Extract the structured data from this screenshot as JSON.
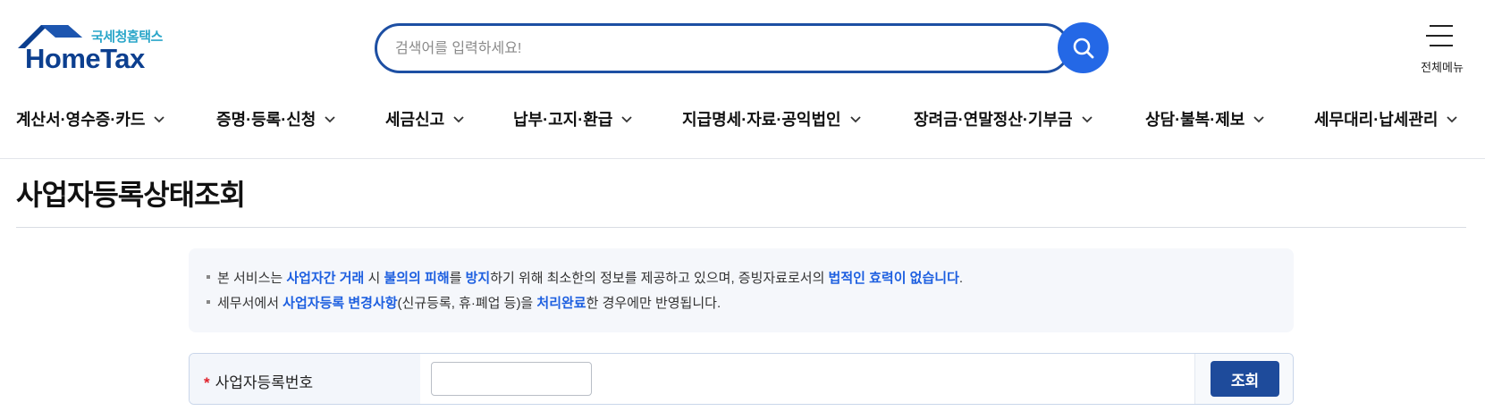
{
  "header": {
    "logo_sub": "국세청홈택스",
    "logo_main": "HomeTax",
    "search_placeholder": "검색어를 입력하세요!",
    "search_value": "",
    "menu_label": "전체메뉴"
  },
  "nav": {
    "items": [
      {
        "label": "계산서·영수증·카드"
      },
      {
        "label": "증명·등록·신청"
      },
      {
        "label": "세금신고"
      },
      {
        "label": "납부·고지·환급"
      },
      {
        "label": "지급명세·자료·공익법인"
      },
      {
        "label": "장려금·연말정산·기부금"
      },
      {
        "label": "상담·불복·제보"
      },
      {
        "label": "세무대리·납세관리"
      }
    ]
  },
  "page": {
    "title": "사업자등록상태조회"
  },
  "notice": {
    "line1": {
      "t1": "본 서비스는 ",
      "h1": "사업자간 거래",
      "t2": " 시 ",
      "h2": "불의의 피해",
      "t3": "를 ",
      "h3": "방지",
      "t4": "하기 위해 최소한의 정보를 제공하고 있으며, 증빙자료로서의 ",
      "h4": "법적인 효력이 없습니다",
      "t5": "."
    },
    "line2": {
      "t1": "세무서에서 ",
      "h1": "사업자등록 변경사항",
      "t2": "(신규등록, 휴·폐업 등)을 ",
      "h2": "처리완료",
      "t3": "한 경우에만 반영됩니다."
    }
  },
  "form": {
    "required_mark": "*",
    "label": "사업자등록번호",
    "input_value": "",
    "button_label": "조회"
  },
  "colors": {
    "brand_navy": "#0c3f8f",
    "search_border": "#1d4fa3",
    "search_button": "#2468e6",
    "highlight": "#1d5fe0",
    "query_button": "#1e4b9b",
    "required": "#e0212b"
  }
}
